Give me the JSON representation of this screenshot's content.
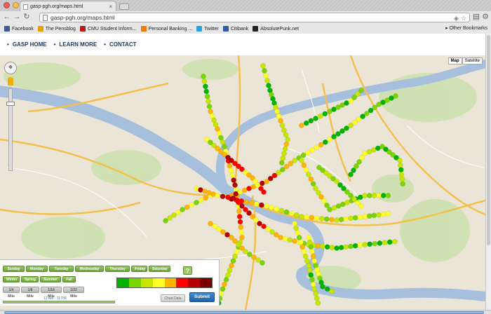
{
  "browser": {
    "tab_title": "gasp-pgh.org/maps.html",
    "url": "gasp-pgh.org/maps.html",
    "bookmarks": [
      {
        "label": "Facebook",
        "icon": "facebook-icon",
        "color": "#3b5998"
      },
      {
        "label": "The Pensblog",
        "icon": "pensblog-icon",
        "color": "#e8a000"
      },
      {
        "label": "CMU Student Inform...",
        "icon": "cmu-icon",
        "color": "#b71c1c"
      },
      {
        "label": "Personal Banking ...",
        "icon": "bank-icon",
        "color": "#f57c00"
      },
      {
        "label": "Twitter",
        "icon": "twitter-icon",
        "color": "#29a3d9"
      },
      {
        "label": "Citibank",
        "icon": "citibank-icon",
        "color": "#2b5aa8"
      },
      {
        "label": "AbsolutePunk.net",
        "icon": "absolutepunk-icon",
        "color": "#222222"
      }
    ],
    "other_bookmarks": "Other Bookmarks"
  },
  "nav": {
    "home": "GASP HOME",
    "learn": "LEARN MORE",
    "contact": "CONTACT"
  },
  "map": {
    "type_map": "Map",
    "type_satellite": "Satellite"
  },
  "controls": {
    "days": [
      "Sunday",
      "Monday",
      "Tuesday",
      "Wednesday",
      "Thursday",
      "Friday",
      "Saturday"
    ],
    "seasons": [
      "Winter",
      "Spring",
      "Summer",
      "Fall"
    ],
    "resolutions": [
      "1/4 Mile",
      "1/8 Mile",
      "1/16 Mile",
      "1/32 Mile"
    ],
    "help": "?",
    "time_range": "12 AM - 11 PM",
    "time_range_fraction": [
      0.0,
      1.0
    ],
    "chart_button": "Chart Data",
    "submit_button": "Submit"
  },
  "legend_colors": [
    "#00b400",
    "#7ad400",
    "#c6e600",
    "#ffff2a",
    "#ffb400",
    "#ff0000",
    "#b40000",
    "#7a0000"
  ]
}
